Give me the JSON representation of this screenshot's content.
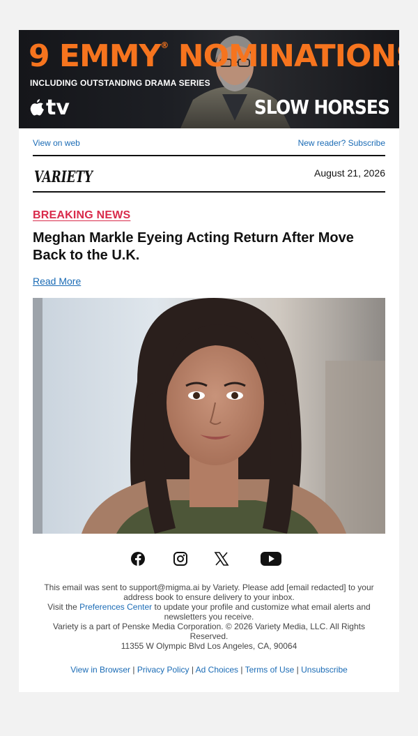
{
  "banner": {
    "headline": "9 EMMY",
    "headline_rest": "NOMINATIONS",
    "registered": "®",
    "subline": "INCLUDING OUTSTANDING DRAMA SERIES",
    "brand": "tv",
    "show_title": "SLOW HORSES",
    "colors": {
      "orange": "#f6741e"
    }
  },
  "toplinks": {
    "view_on_web": "View on web",
    "subscribe": "New reader? Subscribe"
  },
  "masthead": {
    "logo": "VARIETY",
    "date": "August 21, 2026"
  },
  "article": {
    "kicker": "BREAKING NEWS",
    "title": "Meghan Markle Eyeing Acting Return After Move Back to the U.K.",
    "read_more": "Read More"
  },
  "social": {
    "icons": [
      "facebook-icon",
      "instagram-icon",
      "x-icon",
      "youtube-icon"
    ]
  },
  "footer": {
    "line1": "This email was sent to support@migma.ai by Variety. Please add [email redacted] to your address book to ensure delivery to your inbox.",
    "visit": "Visit the",
    "pref_center": "Preferences Center",
    "pref_rest": "to update your profile and customize what email alerts and newsletters you receive.",
    "corp": "Variety is a part of Penske Media Corporation. © 2026 Variety Media, LLC. All Rights Reserved.",
    "address": "11355 W Olympic Blvd Los Angeles, CA, 90064",
    "links": {
      "browser": "View in Browser",
      "privacy": "Privacy Policy",
      "adchoices": "Ad Choices",
      "terms": "Terms of Use",
      "unsubscribe": "Unsubscribe"
    },
    "separator": "|"
  },
  "colors": {
    "link": "#1a6bb5",
    "kicker": "#d92b4b",
    "background": "#f2f2f2"
  }
}
